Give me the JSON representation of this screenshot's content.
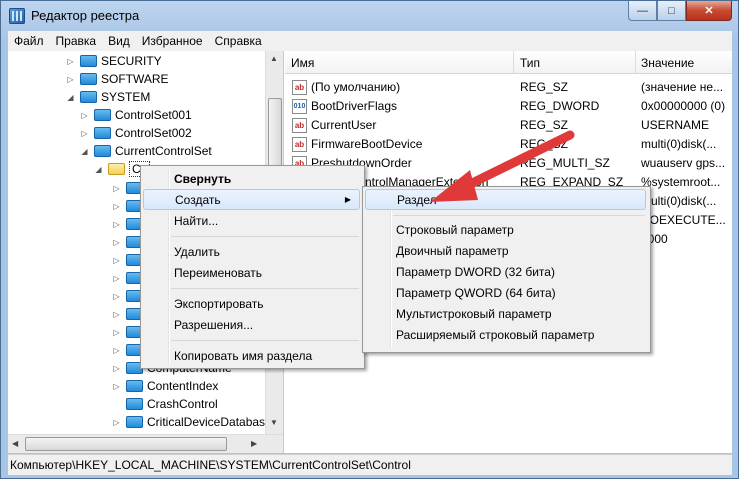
{
  "window": {
    "title": "Редактор реестра",
    "minimize": "—",
    "maximize": "□",
    "close": "✕"
  },
  "menu": [
    "Файл",
    "Правка",
    "Вид",
    "Избранное",
    "Справка"
  ],
  "tree": {
    "nodes": [
      {
        "label": "SECURITY",
        "expander": "▷",
        "open": false
      },
      {
        "label": "SOFTWARE",
        "expander": "▷",
        "open": false
      },
      {
        "label": "SYSTEM",
        "expander": "◢",
        "open": false
      },
      {
        "label": "ControlSet001",
        "expander": "▷",
        "open": false
      },
      {
        "label": "ControlSet002",
        "expander": "▷",
        "open": false
      },
      {
        "label": "CurrentControlSet",
        "expander": "◢",
        "open": false
      },
      {
        "label": "Co",
        "expander": "◢",
        "open": true
      },
      {
        "label": "ComputerName",
        "expander": "▷",
        "open": false
      },
      {
        "label": "ContentIndex",
        "expander": "▷",
        "open": false
      },
      {
        "label": "CrashControl",
        "expander": "",
        "open": false
      },
      {
        "label": "CriticalDeviceDatabas",
        "expander": "▷",
        "open": false
      }
    ],
    "scroll_up": "▲",
    "scroll_down": "▼",
    "scroll_left": "◀",
    "scroll_right": "▶"
  },
  "list": {
    "columns": [
      "Имя",
      "Тип",
      "Значение"
    ],
    "rows": [
      {
        "icon": "ab",
        "name": "(По умолчанию)",
        "type": "REG_SZ",
        "value": "(значение не..."
      },
      {
        "icon": "010",
        "name": "BootDriverFlags",
        "type": "REG_DWORD",
        "value": "0x00000000 (0)"
      },
      {
        "icon": "ab",
        "name": "CurrentUser",
        "type": "REG_SZ",
        "value": "USERNAME"
      },
      {
        "icon": "ab",
        "name": "FirmwareBootDevice",
        "type": "REG_SZ",
        "value": "multi(0)disk(..."
      },
      {
        "icon": "ab",
        "name": "PreshutdownOrder",
        "type": "REG_MULTI_SZ",
        "value": "wuauserv gps..."
      },
      {
        "icon": "ab",
        "name": "ntrolManagerExtension",
        "type": "REG_EXPAND_SZ",
        "value": "%systemroot..."
      },
      {
        "icon": "",
        "name": "",
        "type": "",
        "value": "multi(0)disk(..."
      },
      {
        "icon": "",
        "name": "",
        "type": "",
        "value": "NOEXECUTE..."
      },
      {
        "icon": "",
        "name": "",
        "type": "",
        "value": "2000"
      }
    ]
  },
  "context_menu": {
    "items": [
      "Свернуть",
      "Создать",
      "Найти...",
      "Удалить",
      "Переименовать",
      "Экспортировать",
      "Разрешения...",
      "Копировать имя раздела"
    ],
    "submenu_arrow": "▶"
  },
  "submenu": {
    "items": [
      "Раздел",
      "Строковый параметр",
      "Двоичный параметр",
      "Параметр DWORD (32 бита)",
      "Параметр QWORD (64 бита)",
      "Мультистроковый параметр",
      "Расширяемый строковый параметр"
    ]
  },
  "status": {
    "path": "Компьютер\\HKEY_LOCAL_MACHINE\\SYSTEM\\CurrentControlSet\\Control"
  },
  "colors": {
    "highlight_arrow": "#e0393a",
    "title_bg": "#a9c5e6"
  }
}
